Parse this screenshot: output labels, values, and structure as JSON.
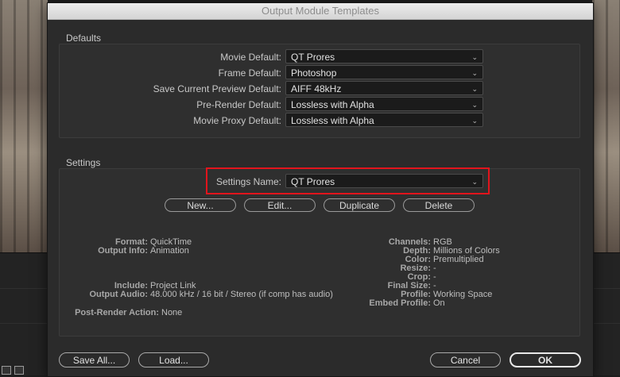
{
  "dialog": {
    "title": "Output Module Templates"
  },
  "defaults": {
    "heading": "Defaults",
    "rows": [
      {
        "label": "Movie Default:",
        "value": "QT Prores"
      },
      {
        "label": "Frame Default:",
        "value": "Photoshop"
      },
      {
        "label": "Save Current Preview Default:",
        "value": "AIFF 48kHz"
      },
      {
        "label": "Pre-Render Default:",
        "value": "Lossless with Alpha"
      },
      {
        "label": "Movie Proxy Default:",
        "value": "Lossless with Alpha"
      }
    ]
  },
  "settings": {
    "heading": "Settings",
    "name_label": "Settings Name:",
    "name_value": "QT Prores",
    "buttons": {
      "new": "New...",
      "edit": "Edit...",
      "duplicate": "Duplicate",
      "delete": "Delete"
    },
    "left_info": {
      "format_label": "Format:",
      "format": "QuickTime",
      "output_info_label": "Output Info:",
      "output_info": "Animation",
      "include_label": "Include:",
      "include": "Project Link",
      "output_audio_label": "Output Audio:",
      "output_audio": "48.000 kHz / 16 bit / Stereo (if comp has audio)",
      "post_render_label": "Post-Render Action:",
      "post_render": "None"
    },
    "right_info": {
      "channels_label": "Channels:",
      "channels": "RGB",
      "depth_label": "Depth:",
      "depth": "Millions of Colors",
      "color_label": "Color:",
      "color": "Premultiplied",
      "resize_label": "Resize:",
      "resize": "-",
      "crop_label": "Crop:",
      "crop": "-",
      "final_size_label": "Final Size:",
      "final_size": "-",
      "profile_label": "Profile:",
      "profile": "Working Space",
      "embed_profile_label": "Embed Profile:",
      "embed_profile": "On"
    }
  },
  "footer": {
    "save_all": "Save All...",
    "load": "Load...",
    "cancel": "Cancel",
    "ok": "OK"
  },
  "icons": {
    "chevron": "chevron-down-icon"
  },
  "colors": {
    "highlight": "#e2141c"
  }
}
